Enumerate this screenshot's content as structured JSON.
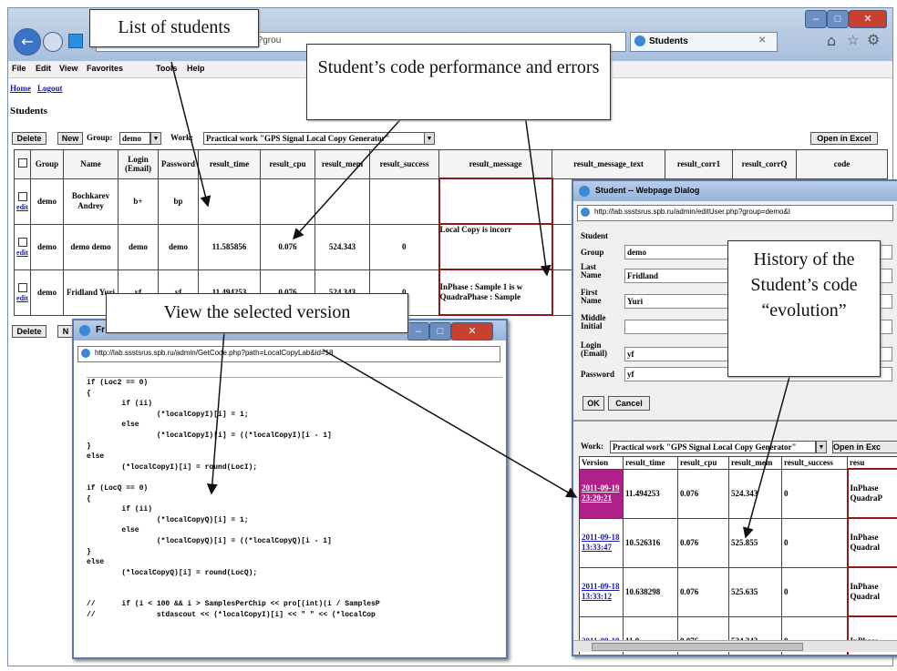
{
  "browser": {
    "address_text": "php?grou",
    "tab_label": "Students",
    "tab_close": "✕",
    "menu": [
      "File",
      "Edit",
      "View",
      "Favorites",
      "Tools",
      "Help"
    ],
    "win_buttons": [
      "–",
      "□",
      "✕"
    ]
  },
  "page": {
    "home_link": "Home",
    "logout_link": "Logout",
    "heading": "Students",
    "toolbar": {
      "delete_label": "Delete",
      "new_label": "New",
      "group_label": "Group:",
      "group_value": "demo",
      "work_label": "Work:",
      "work_value": "Practical work \"GPS Signal Local Copy Generator\"",
      "open_excel_label": "Open in Excel"
    },
    "columns": [
      "",
      "Group",
      "Name",
      "Login (Email)",
      "Password",
      "result_time",
      "result_cpu",
      "result_mem",
      "result_success",
      "result_message",
      "result_message_text",
      "result_corr1",
      "result_corrQ",
      "code"
    ],
    "rows": [
      {
        "edit": "edit",
        "group": "demo",
        "name": "Bochkarev Andrey",
        "login": "b+",
        "password": "bp",
        "time": "",
        "cpu": "",
        "mem": "",
        "success": "",
        "message": ""
      },
      {
        "edit": "edit",
        "group": "demo",
        "name": "demo demo",
        "login": "demo",
        "password": "demo",
        "time": "11.585856",
        "cpu": "0.076",
        "mem": "524.343",
        "success": "0",
        "message": "Local Copy is incorr"
      },
      {
        "edit": "edit",
        "group": "demo",
        "name": "Fridland Yuri",
        "login": "yf",
        "password": "yf",
        "time": "11.494253",
        "cpu": "0.076",
        "mem": "524.343",
        "success": "0",
        "message": "InPhase : Sample 1 is w QuadraPhase : Sample"
      }
    ],
    "bottom_delete": "Delete",
    "bottom_new": "N"
  },
  "code_window": {
    "title": "Fr",
    "address": "http://lab.ssstsrus.spb.ru/admin/GetCode.php?path=LocalCopyLab&id=18",
    "lines": [
      "if (Loc2 == 0)",
      "{",
      "        if (ii)",
      "                (*localCopyI)[i] = 1;",
      "        else",
      "                (*localCopyI)[i] = ((*localCopyI)[i - 1]",
      "}",
      "else",
      "        (*localCopyI)[i] = round(LocI);",
      "",
      "if (LocQ == 0)",
      "{",
      "        if (ii)",
      "                (*localCopyQ)[i] = 1;",
      "        else",
      "                (*localCopyQ)[i] = ((*localCopyQ)[i - 1] ",
      "}",
      "else",
      "        (*localCopyQ)[i] = round(LocQ);",
      "",
      "",
      "//      if (i < 100 && i > SamplesPerChip << pro[(int)(i / SamplesP",
      "//              stdascout << (*localCopyI)[i] << \" \" << (*localCop"
    ]
  },
  "dialog": {
    "title": "Student -- Webpage Dialog",
    "address": "http://lab.ssstsrus.spb.ru/admin/editUser.php?group=demo&I",
    "fields": [
      {
        "label": "Student",
        "value": ""
      },
      {
        "label": "Group",
        "value": "demo"
      },
      {
        "label": "Last Name",
        "value": "Fridland"
      },
      {
        "label": "First Name",
        "value": "Yuri"
      },
      {
        "label": "Middle Initial",
        "value": ""
      },
      {
        "label": "Login (Email)",
        "value": "yf"
      },
      {
        "label": "Password",
        "value": "yf"
      }
    ],
    "ok_label": "OK",
    "cancel_label": "Cancel",
    "work_label": "Work:",
    "work_value": "Practical work \"GPS Signal Local Copy Generator\"",
    "open_excel_label": "Open in Exc",
    "version_columns": [
      "Version",
      "result_time",
      "result_cpu",
      "result_mem",
      "result_success",
      "resu"
    ],
    "versions": [
      {
        "date": "2011-09-19 23:20:21",
        "time": "11.494253",
        "cpu": "0.076",
        "mem": "524.343",
        "success": "0",
        "msg": "InPhase QuadraP"
      },
      {
        "date": "2011-09-18 13:33:47",
        "time": "10.526316",
        "cpu": "0.076",
        "mem": "525.855",
        "success": "0",
        "msg": "InPhase Quadral"
      },
      {
        "date": "2011-09-18 13:33:12",
        "time": "10.638298",
        "cpu": "0.076",
        "mem": "525.635",
        "success": "0",
        "msg": "InPhase Quadral"
      },
      {
        "date": "2011-09-18",
        "time": "11.0",
        "cpu": "0.076",
        "mem": "524.343",
        "success": "0",
        "msg": "InPhase"
      }
    ]
  },
  "callouts": {
    "list_students": "List of students",
    "performance": "Student’s code performance and errors",
    "view_version": "View the selected version",
    "history": "History of the Student’s code “evolution”"
  },
  "colors": {
    "link": "#1a1ab0",
    "selected_version": "#b0208a",
    "error_border": "#8b1a1a"
  }
}
